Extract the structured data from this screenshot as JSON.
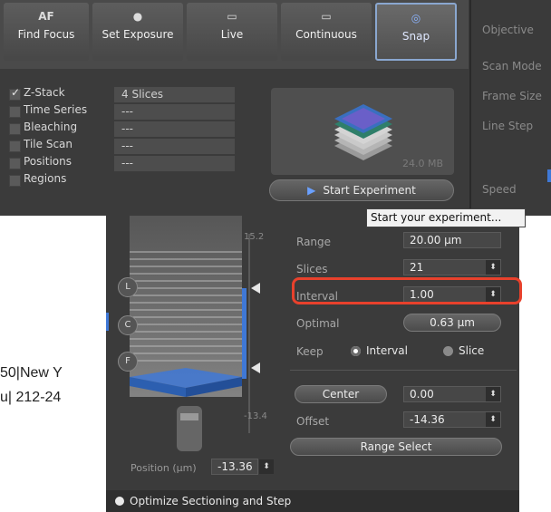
{
  "toolbar": {
    "buttons": [
      {
        "label": "Find Focus",
        "icon_text": "AF",
        "icon": "af-icon"
      },
      {
        "label": "Set Exposure",
        "icon_text": "●",
        "icon": "camera-icon"
      },
      {
        "label": "Live",
        "icon_text": "▭",
        "icon": "live-icon"
      },
      {
        "label": "Continuous",
        "icon_text": "▭",
        "icon": "continuous-icon"
      },
      {
        "label": "Snap",
        "icon_text": "◎",
        "icon": "snap-icon"
      }
    ]
  },
  "settings": {
    "objective": "Objective",
    "scan_mode": "Scan Mode",
    "frame_size": "Frame Size",
    "line_step": "Line Step",
    "speed": "Speed"
  },
  "experiment": {
    "rows": [
      {
        "label": "Z-Stack",
        "checked": true,
        "value": "4 Slices"
      },
      {
        "label": "Time Series",
        "checked": false,
        "value": "---"
      },
      {
        "label": "Bleaching",
        "checked": false,
        "value": "---"
      },
      {
        "label": "Tile Scan",
        "checked": false,
        "value": "---"
      },
      {
        "label": "Positions",
        "checked": false,
        "value": "---"
      },
      {
        "label": "Regions",
        "checked": false,
        "value": ""
      }
    ],
    "data_size": "24.0 MB",
    "start_button": "Start Experiment",
    "tooltip": "Start your experiment..."
  },
  "zstack": {
    "top_value": "15.2",
    "bottom_value": "-13.4",
    "range_label": "Range",
    "range_value": "20.00 µm",
    "slices_label": "Slices",
    "slices_value": "21",
    "interval_label": "Interval",
    "interval_value": "1.00",
    "optimal_label": "Optimal",
    "optimal_value": "0.63 µm",
    "keep_label": "Keep",
    "keep_interval": "Interval",
    "keep_slice": "Slice",
    "center_button": "Center",
    "center_value": "0.00",
    "offset_label": "Offset",
    "offset_value": "-14.36",
    "range_select": "Range Select",
    "position_label": "Position (µm)",
    "position_value": "-13.36",
    "side_buttons": [
      "L",
      "C",
      "F"
    ],
    "footer": "Optimize Sectioning and Step"
  },
  "background_text": {
    "line1": "50|New Y",
    "line2": "u| 212-24"
  },
  "colors": {
    "accent": "#3f78d6",
    "highlight": "#e8412c"
  }
}
